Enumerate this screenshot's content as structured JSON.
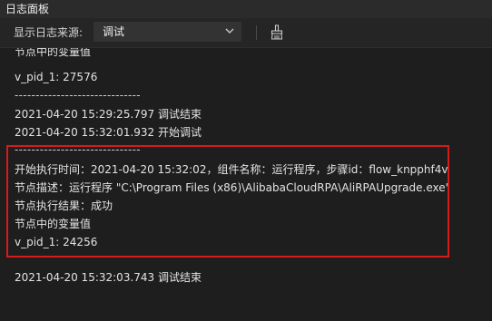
{
  "panel": {
    "title": "日志面板"
  },
  "toolbar": {
    "source_label": "显示日志来源:",
    "source_selected": "调试",
    "icons": [
      "chevron-down-icon",
      "broom-clear-icon"
    ]
  },
  "log": {
    "top_cut": "节点中的变量值",
    "lines_before": [
      "v_pid_1: 27576",
      "------------------------------",
      "2021-04-20 15:29:25.797 调试结束",
      "2021-04-20 15:32:01.932 开始调试",
      "------------------------------"
    ],
    "highlighted": [
      "开始执行时间：2021-04-20 15:32:02，组件名称：运行程序，步骤id：flow_knpphf4v",
      "节点描述：运行程序 \"C:\\Program Files (x86)\\AlibabaCloudRPA\\AliRPAUpgrade.exe\"",
      "节点执行结果：成功",
      "节点中的变量值",
      "v_pid_1: 24256"
    ],
    "after": "2021-04-20 15:32:03.743 调试结束"
  },
  "colors": {
    "background": "#1e1e1e",
    "highlight_border": "#d71a1a",
    "text": "#e3e3e3"
  }
}
